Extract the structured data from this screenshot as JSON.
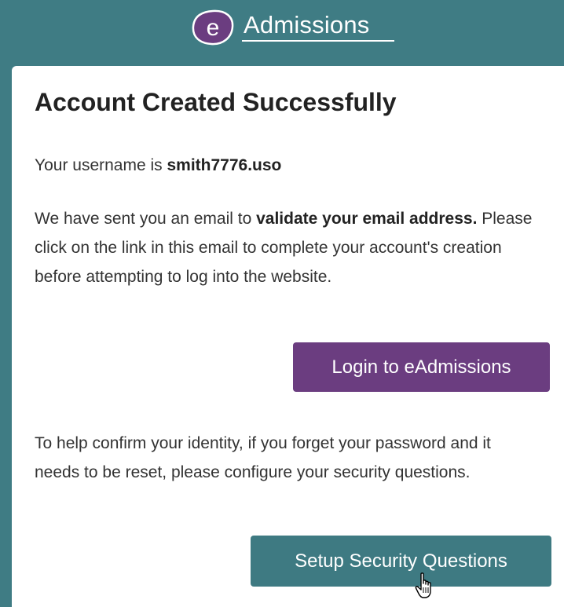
{
  "header": {
    "logo_letter": "e",
    "logo_text": "Admissions"
  },
  "card": {
    "title": "Account Created Successfully",
    "username_prefix": "Your username is ",
    "username": "smith7776.uso",
    "email_text_1": "We have sent you an email to ",
    "email_bold": "validate your email address.",
    "email_text_2": " Please click on the link in this email to complete your account's creation before attempting to log into the website.",
    "login_button": "Login to eAdmissions",
    "identity_text": "To help confirm your identity, if you forget your password and it needs to be reset, please configure your security questions.",
    "security_button": "Setup Security Questions"
  },
  "icons": {
    "cursor": "hand-pointer-icon"
  },
  "colors": {
    "background": "#3f7c84",
    "login_button": "#6b3d80",
    "security_button": "#3e7a82"
  }
}
